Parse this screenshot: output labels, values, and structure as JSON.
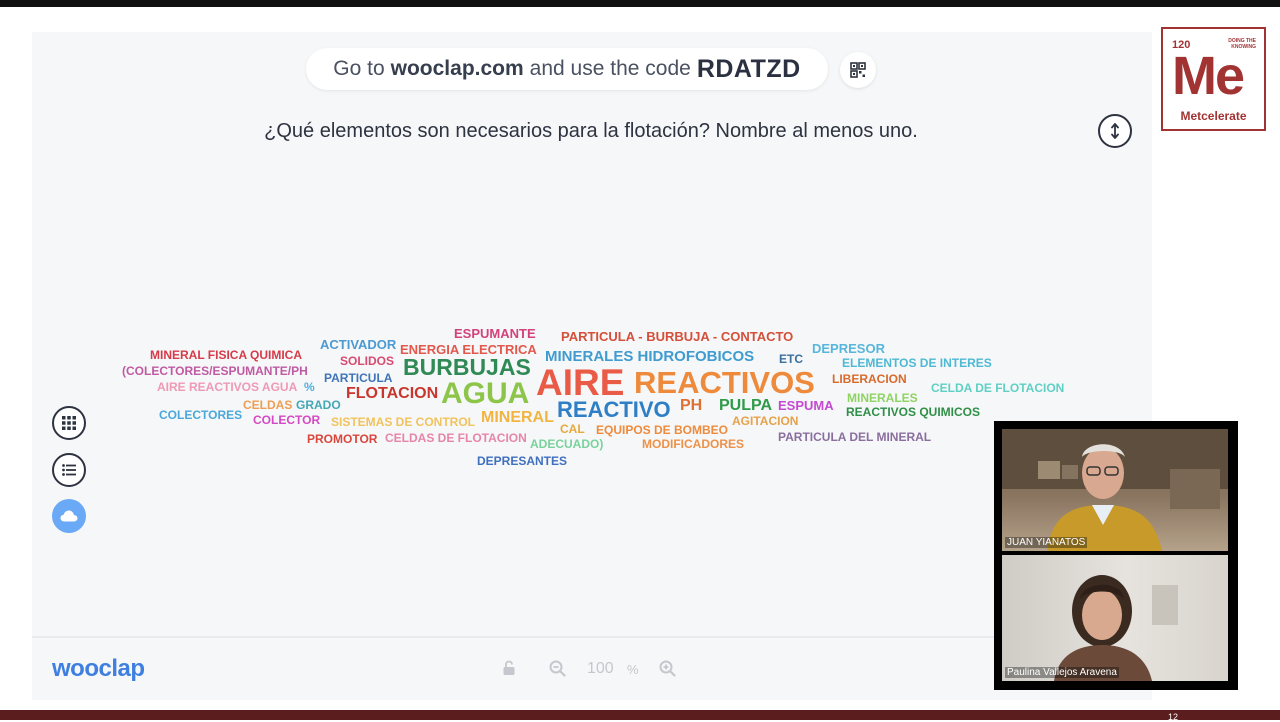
{
  "join": {
    "prefix": "Go to",
    "site": "wooclap.com",
    "middle": "and use the code",
    "code": "RDATZD"
  },
  "question": "¿Qué elementos son necesarios para la flotación? Nombre al menos uno.",
  "cloud_words": [
    {
      "text": "ESPUMANTE",
      "color": "#d2437b"
    },
    {
      "text": "PARTICULA - BURBUJA - CONTACTO",
      "color": "#d4503a"
    },
    {
      "text": "ACTIVADOR",
      "color": "#4c9ad2"
    },
    {
      "text": "DEPRESOR",
      "color": "#57b6dc"
    },
    {
      "text": "MINERAL FISICA QUIMICA",
      "color": "#d53b49"
    },
    {
      "text": "ENERGIA ELECTRICA",
      "color": "#e2584d"
    },
    {
      "text": "MINERALES HIDROFOBICOS",
      "color": "#3f9bd0"
    },
    {
      "text": "ETC",
      "color": "#3b6f9e"
    },
    {
      "text": "SOLIDOS",
      "color": "#d94a72"
    },
    {
      "text": "ELEMENTOS DE INTERES",
      "color": "#4fb9d3"
    },
    {
      "text": "(COLECTORES/ESPUMANTE/PH",
      "color": "#c05aa3"
    },
    {
      "text": "BURBUJAS",
      "color": "#2f8a55"
    },
    {
      "text": "PARTICULA",
      "color": "#3f74b8"
    },
    {
      "text": "LIBERACION",
      "color": "#d96a2b"
    },
    {
      "text": "AIRE REACTIVOS AGUA",
      "color": "#ef99b5"
    },
    {
      "text": "%",
      "color": "#4faee0"
    },
    {
      "text": "AIRE",
      "color": "#e95b47"
    },
    {
      "text": "REACTIVOS",
      "color": "#ee8a3b"
    },
    {
      "text": "CELDA DE FLOTACION",
      "color": "#5fd0c4"
    },
    {
      "text": "AGUA",
      "color": "#8dc54a"
    },
    {
      "text": "FLOTACION",
      "color": "#c8362d"
    },
    {
      "text": "MINERALES",
      "color": "#8fd364"
    },
    {
      "text": "CELDAS",
      "color": "#ec9e54"
    },
    {
      "text": "GRADO",
      "color": "#44a7b6"
    },
    {
      "text": "COLECTORES",
      "color": "#4aa8da"
    },
    {
      "text": "PH",
      "color": "#de7033"
    },
    {
      "text": "PULPA",
      "color": "#2f9a4a"
    },
    {
      "text": "ESPUMA",
      "color": "#c34bd1"
    },
    {
      "text": "REACTIVO",
      "color": "#2f7fc6"
    },
    {
      "text": "REACTIVOS QUIMICOS",
      "color": "#2f8f47"
    },
    {
      "text": "COLECTOR",
      "color": "#d44ac4"
    },
    {
      "text": "MINERAL",
      "color": "#f2b542"
    },
    {
      "text": "SISTEMAS DE CONTROL",
      "color": "#f1c35d"
    },
    {
      "text": "AGITACION",
      "color": "#e6a24a"
    },
    {
      "text": "CAL",
      "color": "#e6a93d"
    },
    {
      "text": "EQUIPOS DE BOMBEO",
      "color": "#ee8b3c"
    },
    {
      "text": "PROMOTOR",
      "color": "#d8473d"
    },
    {
      "text": "CELDAS DE FLOTACION",
      "color": "#e785a8"
    },
    {
      "text": "PARTICULA DEL MINERAL",
      "color": "#8a6f9e"
    },
    {
      "text": "ADECUADO)",
      "color": "#79d29c"
    },
    {
      "text": "MODIFICADORES",
      "color": "#ee9148"
    },
    {
      "text": "DEPRESANTES",
      "color": "#3f6fbf"
    }
  ],
  "footer": {
    "logo": "wooclap",
    "zoom_value": "100",
    "zoom_unit": "%"
  },
  "brand": {
    "number": "120",
    "tagline": "DOING THE KNOWING",
    "symbol": "Me",
    "name": "Metcelerate"
  },
  "video": {
    "participant1": "JUAN YIANATOS",
    "participant2": "Paulina Vallejos Aravena"
  },
  "page_number": "12",
  "colors": {
    "accent": "#6aa9f5",
    "brand": "#a23333",
    "wooclap_blue": "#3f7fe0"
  }
}
